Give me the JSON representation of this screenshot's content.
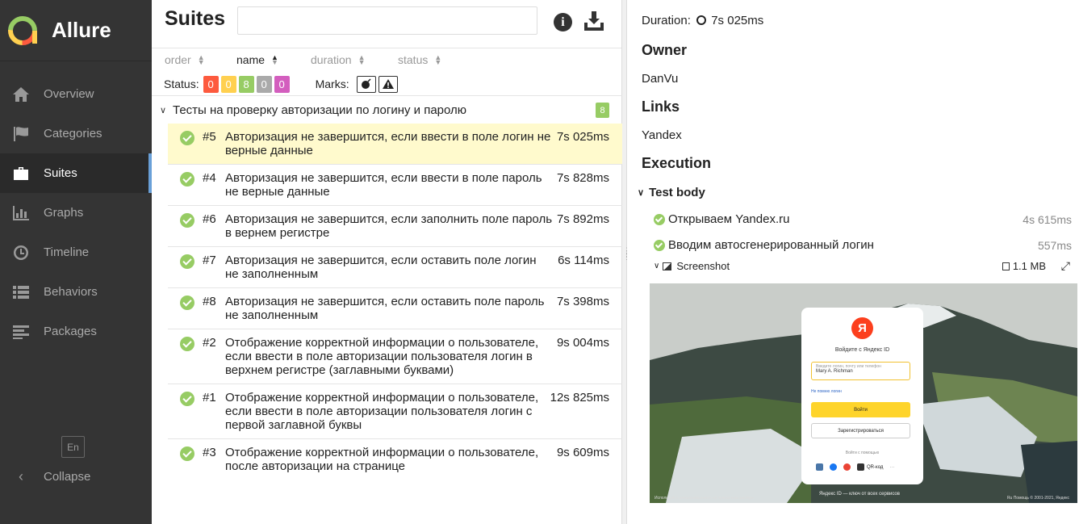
{
  "app": {
    "name": "Allure"
  },
  "sidebar": {
    "items": [
      {
        "label": "Overview",
        "icon": "home-icon"
      },
      {
        "label": "Categories",
        "icon": "flag-icon"
      },
      {
        "label": "Suites",
        "icon": "briefcase-icon",
        "active": true
      },
      {
        "label": "Graphs",
        "icon": "bar-chart-icon"
      },
      {
        "label": "Timeline",
        "icon": "clock-icon"
      },
      {
        "label": "Behaviors",
        "icon": "list-icon"
      },
      {
        "label": "Packages",
        "icon": "align-left-icon"
      }
    ],
    "lang": "En",
    "collapse": "Collapse"
  },
  "suites": {
    "title": "Suites",
    "search_value": "",
    "sort": [
      "order",
      "name",
      "duration",
      "status"
    ],
    "status_label": "Status:",
    "status_counts": [
      {
        "value": "0",
        "color": "#fd5a3e"
      },
      {
        "value": "0",
        "color": "#ffd050"
      },
      {
        "value": "8",
        "color": "#97cc64"
      },
      {
        "value": "0",
        "color": "#aaaaaa"
      },
      {
        "value": "0",
        "color": "#d35ebe"
      }
    ],
    "marks_label": "Marks:",
    "group": {
      "name": "Тесты на проверку авторизации по логину и паролю",
      "count": "8"
    },
    "tests": [
      {
        "num": "#5",
        "name": "Авторизация не завершится, если ввести в поле логин не верные данные",
        "dur": "7s 025ms"
      },
      {
        "num": "#4",
        "name": "Авторизация не завершится, если ввести в поле пароль не верные данные",
        "dur": "7s 828ms"
      },
      {
        "num": "#6",
        "name": "Авторизация не завершится, если заполнить поле пароль в вернем регистре",
        "dur": "7s 892ms"
      },
      {
        "num": "#7",
        "name": "Авторизация не завершится, если оставить поле логин не заполненным",
        "dur": "6s 114ms"
      },
      {
        "num": "#8",
        "name": "Авторизация не завершится, если оставить поле пароль не заполненным",
        "dur": "7s 398ms"
      },
      {
        "num": "#2",
        "name": "Отображение корректной информации о пользователе, если ввести в поле авторизации пользователя логин в верхнем регистре (заглавными буквами)",
        "dur": "9s 004ms"
      },
      {
        "num": "#1",
        "name": "Отображение корректной информации о пользователе, если ввести в поле авторизации пользователя логин с первой заглавной буквы",
        "dur": "12s 825ms"
      },
      {
        "num": "#3",
        "name": "Отображение корректной информации о пользователе, после авторизации на странице",
        "dur": "9s 609ms"
      }
    ]
  },
  "details": {
    "duration_label": "Duration:",
    "duration": "7s 025ms",
    "owner_h": "Owner",
    "owner": "DanVu",
    "links_h": "Links",
    "link": "Yandex",
    "execution_h": "Execution",
    "test_body": "Test body",
    "steps": [
      {
        "name": "Открываем Yandex.ru",
        "dur": "4s 615ms"
      },
      {
        "name": "Вводим автосгенерированный логин",
        "dur": "557ms"
      }
    ],
    "attachment": {
      "name": "Screenshot",
      "size": "1.1 MB"
    },
    "screenshot": {
      "title": "Войдите с Яндекс ID",
      "field_placeholder": "Введите логин, почту или телефон",
      "field_value": "Mary A. Richman",
      "forgot": "Не помню логин",
      "login": "Войти",
      "register": "Зарегистрироваться",
      "or": "Войти с помощью",
      "qr": "QR-код",
      "footer_left": "Используйте режим инкогнито на чужом компьютере",
      "footer_center": "Яндекс ID — ключ от всех сервисов",
      "footer_right": "Ru   Помощь   © 2001-2021, Яндекс"
    }
  }
}
